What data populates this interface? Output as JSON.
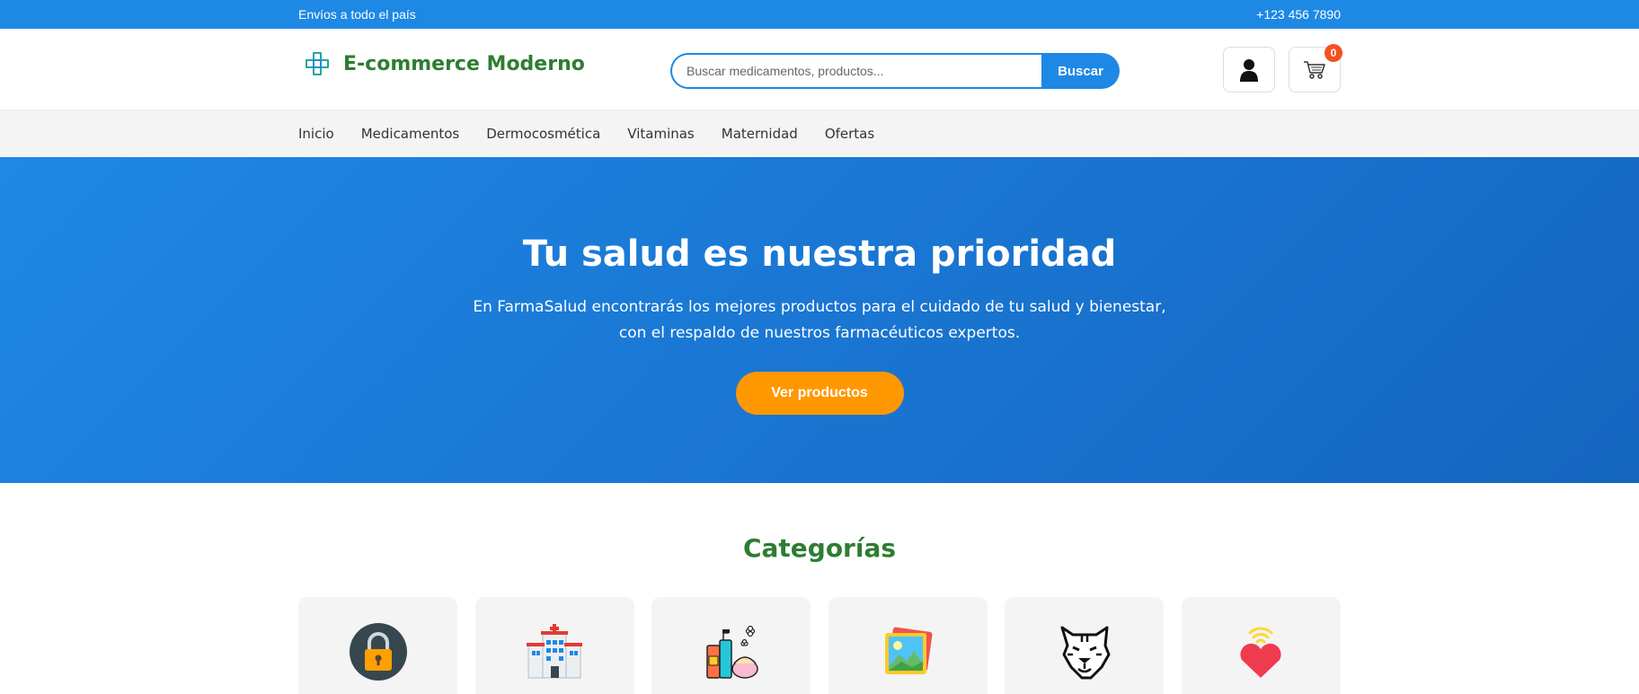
{
  "topbar": {
    "left_text": "Envíos a todo el país",
    "right_text": "+123 456 7890"
  },
  "header": {
    "logo_text": "E-commerce Moderno",
    "logo_icon": "medical-cross-icon",
    "search": {
      "placeholder": "Buscar medicamentos, productos...",
      "value": "",
      "button_label": "Buscar"
    },
    "user_icon": "user-icon",
    "cart_icon": "cart-icon",
    "cart_count": "0"
  },
  "nav": {
    "items": [
      {
        "label": "Inicio"
      },
      {
        "label": "Medicamentos"
      },
      {
        "label": "Dermocosmética"
      },
      {
        "label": "Vitaminas"
      },
      {
        "label": "Maternidad"
      },
      {
        "label": "Ofertas"
      }
    ]
  },
  "hero": {
    "title": "Tu salud es nuestra prioridad",
    "description": "En FarmaSalud encontrarás los mejores productos para el cuidado de tu salud y bienestar, con el respaldo de nuestros farmacéuticos expertos.",
    "cta_label": "Ver productos"
  },
  "categories": {
    "title": "Categorías",
    "items": [
      {
        "icon": "padlock-icon"
      },
      {
        "icon": "hospital-icon"
      },
      {
        "icon": "cosmetics-icon"
      },
      {
        "icon": "image-gallery-icon"
      },
      {
        "icon": "tiger-icon"
      },
      {
        "icon": "heart-signal-icon"
      }
    ]
  },
  "colors": {
    "primary": "#1e88e5",
    "brand_green": "#2e7d32",
    "cta_orange": "#ff9800",
    "badge": "#f4511e"
  }
}
